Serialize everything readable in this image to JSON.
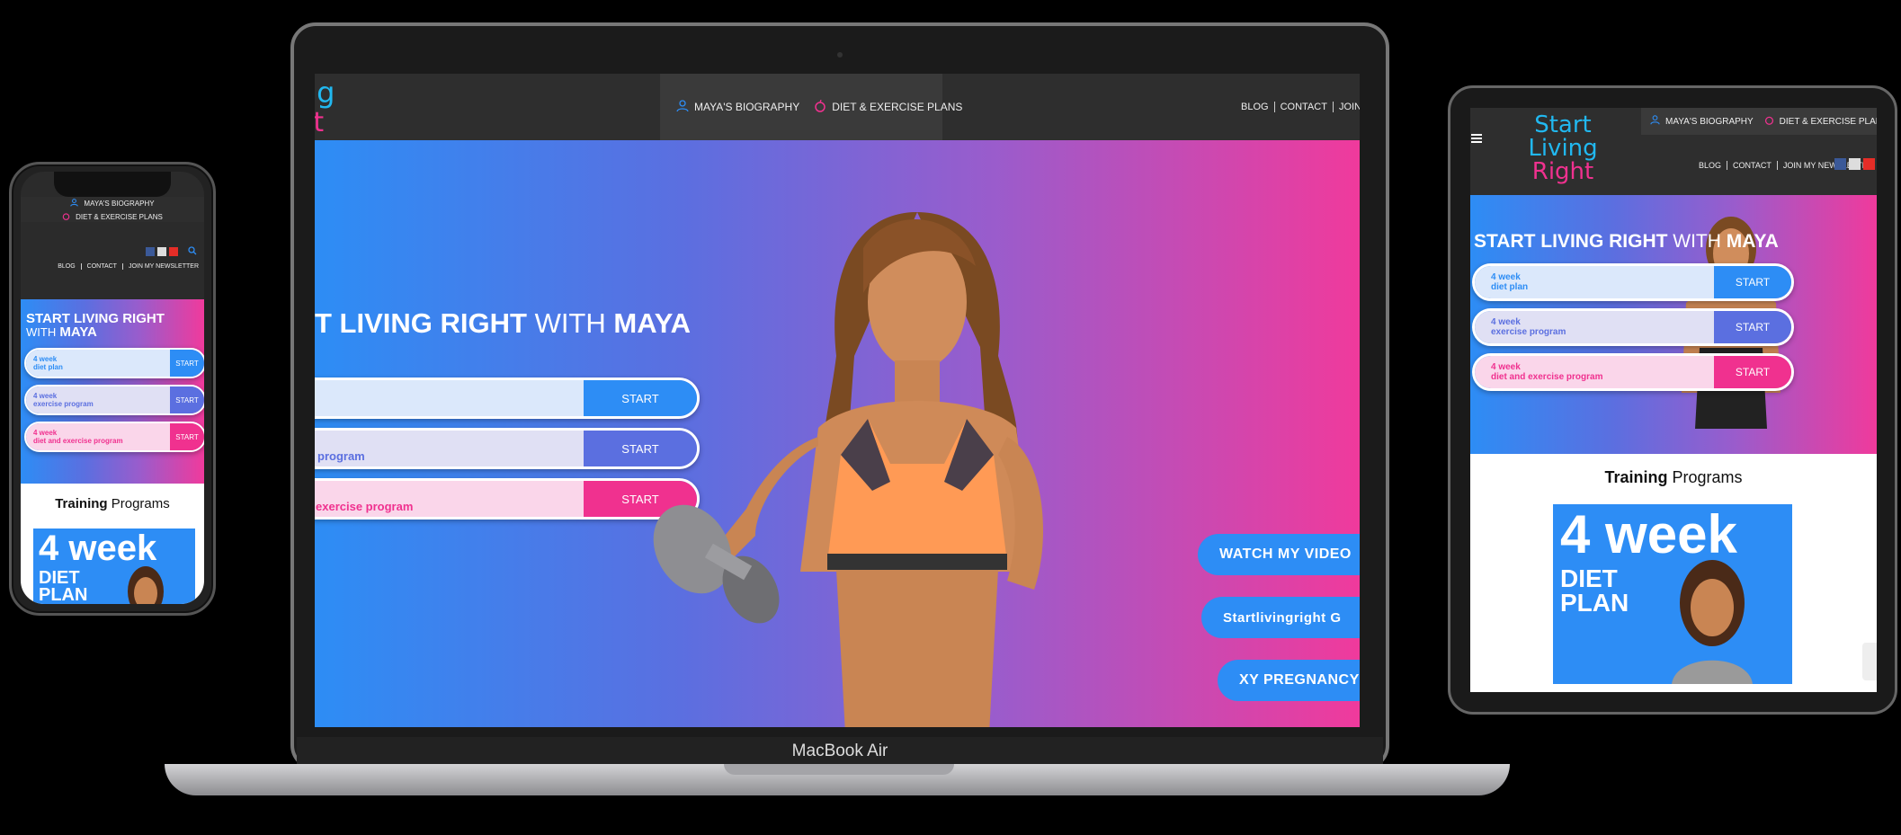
{
  "brand": {
    "logo_line1": "Start Living",
    "logo_line2": "Right"
  },
  "nav": {
    "biography": "MAYA'S BIOGRAPHY",
    "plans": "DIET & EXERCISE PLANS",
    "blog": "BLOG",
    "contact": "CONTACT",
    "newsletter": "JOIN MY NEWSLETTER",
    "newsletter_cut": "JOIN MY"
  },
  "hero": {
    "title_bold": "START LIVING RIGHT",
    "title_with": "WITH",
    "title_name": "MAYA",
    "title_cut": "T LIVING RIGHT",
    "phone_title_line1": "START LIVING RIGHT",
    "phone_title_with": "WITH",
    "cta": [
      {
        "line1": "4 week",
        "line2": "diet plan",
        "button": "START",
        "laptop_line2": ""
      },
      {
        "line1": "4 week",
        "line2": "exercise program",
        "button": "START",
        "laptop_line2": "program"
      },
      {
        "line1": "4 week",
        "line2": "diet and exercise program",
        "button": "START",
        "laptop_line2": "exercise program"
      }
    ],
    "pills": [
      "WATCH MY VIDEO",
      "Startlivingright G",
      "XY PREGNANCY"
    ]
  },
  "training": {
    "bold": "Training",
    "rest": "Programs"
  },
  "card": {
    "big": "4 week",
    "sub1": "DIET",
    "sub2": "PLAN"
  },
  "device": {
    "laptop_label": "MacBook Air"
  },
  "colors": {
    "blue": "#2d8df5",
    "purple": "#5b6fe0",
    "pink": "#f0318f",
    "nav": "#2e2e2e"
  },
  "icons": {
    "biography": "person-icon",
    "plans": "apple-icon",
    "menu": "hamburger-icon",
    "search": "search-icon"
  }
}
